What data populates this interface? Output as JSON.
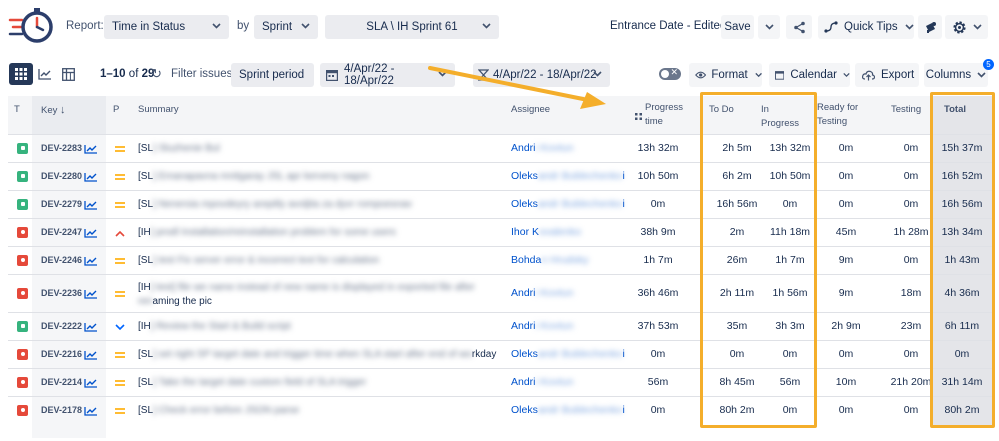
{
  "toolbar": {
    "report_label": "Report:",
    "report_value": "Time in Status",
    "by_label": "by",
    "groupby_value": "Sprint",
    "sprint_value": "SLA \\ IH Sprint 61",
    "entrance_date": "Entrance Date - Edited",
    "save_label": "Save",
    "quick_tips_label": "Quick Tips"
  },
  "controls": {
    "range_label": "1–10",
    "range_of": "of",
    "range_total": "29",
    "filter_label": "Filter issues:",
    "filter_value": "Sprint period",
    "date_range_1": "4/Apr/22 - 18/Apr/22",
    "date_range_2": "4/Apr/22 - 18/Apr/22",
    "format_label": "Format",
    "calendar_label": "Calendar",
    "export_label": "Export",
    "columns_label": "Columns",
    "columns_badge": "5"
  },
  "table": {
    "headers": {
      "type": "T",
      "key": "Key",
      "priority": "P",
      "summary": "Summary",
      "assignee": "Assignee",
      "progress_line1": "Progress",
      "progress_line2": "time",
      "todo": "To Do",
      "inprogress_line1": "In",
      "inprogress_line2": "Progress",
      "ready_line1": "Ready for",
      "ready_line2": "Testing",
      "testing": "Testing",
      "total": "Total"
    },
    "rows": [
      {
        "type": "story",
        "key": "DEV-2283",
        "priority": "medium",
        "summary": "[SL] Sluzhenie Bul",
        "summary_extra": "",
        "assignee": "Andri",
        "assignee_hidden": "i Kovtun",
        "progress": "13h 32m",
        "todo": "2h 5m",
        "inprogress": "13h 32m",
        "ready": "0m",
        "testing": "0m",
        "total": "15h 37m"
      },
      {
        "type": "story",
        "key": "DEV-2280",
        "priority": "medium",
        "summary": "[SL] Emanapavna mnitgaray  JSL apr kerveny nagon",
        "summary_extra": "",
        "assignee": "Oleks",
        "assignee_hidden": "andr Bublechenko",
        "assignee_tail": "i",
        "progress": "10h 50m",
        "todo": "6h 2m",
        "inprogress": "10h 50m",
        "ready": "0m",
        "testing": "0m",
        "total": "16h 52m"
      },
      {
        "type": "story",
        "key": "DEV-2279",
        "priority": "medium",
        "summary": "[SL] Nenersia mpovdeyry arepitly avoljita za dyvr rompoesnav",
        "summary_extra": "",
        "assignee": "Oleks",
        "assignee_hidden": "andr Bublechenko",
        "assignee_tail": "i",
        "progress": "0m",
        "todo": "16h 56m",
        "inprogress": "0m",
        "ready": "0m",
        "testing": "0m",
        "total": "16h 56m"
      },
      {
        "type": "bug",
        "key": "DEV-2247",
        "priority": "high",
        "summary": "[IH] prodl Installation/reinstallation problem for some users",
        "summary_extra": "",
        "assignee": "Ihor K",
        "assignee_hidden": "ovalenko",
        "assignee_tail": "",
        "progress": "38h 9m",
        "todo": "2m",
        "inprogress": "11h 18m",
        "ready": "45m",
        "testing": "1h 28m",
        "total": "13h 34m"
      },
      {
        "type": "bug",
        "key": "DEV-2246",
        "priority": "medium",
        "summary": "[SL] test Fix server error & incorrect text for calculation",
        "summary_extra": "",
        "assignee": "Bohda",
        "assignee_hidden": "n Hrudsky",
        "assignee_tail": "",
        "progress": "1h 7m",
        "todo": "26m",
        "inprogress": "1h 7m",
        "ready": "9m",
        "testing": "0m",
        "total": "1h 43m"
      },
      {
        "type": "bug",
        "key": "DEV-2236",
        "priority": "medium",
        "summary": "[IH] test] file we name instead of new name is displayed in exported file after",
        "summary_extra": "renaming the pic",
        "assignee": "Andri",
        "assignee_hidden": "i Kovtun",
        "assignee_tail": "",
        "progress": "36h 46m",
        "todo": "2h 11m",
        "inprogress": "1h 56m",
        "ready": "9m",
        "testing": "18m",
        "total": "4h 36m"
      },
      {
        "type": "story",
        "key": "DEV-2222",
        "priority": "low",
        "summary": "[IH] Review the Start & Build script",
        "summary_extra": "",
        "assignee": "Andri",
        "assignee_hidden": "i Kovtun",
        "assignee_tail": "",
        "progress": "37h 53m",
        "todo": "35m",
        "inprogress": "3h 3m",
        "ready": "2h 9m",
        "testing": "23m",
        "total": "6h 11m"
      },
      {
        "type": "bug",
        "key": "DEV-2216",
        "priority": "medium",
        "summary": "[SL] set right SP target date and trigger time when SLA start after end of wo",
        "summary_tail": "rkday",
        "summary_extra": "",
        "assignee": "Oleks",
        "assignee_hidden": "andr Bublechenko",
        "assignee_tail": "i",
        "progress": "0m",
        "todo": "0m",
        "inprogress": "0m",
        "ready": "0m",
        "testing": "0m",
        "total": "0m"
      },
      {
        "type": "bug",
        "key": "DEV-2214",
        "priority": "medium",
        "summary": "[SL] Take the target date custom field of SLA trigger",
        "summary_extra": "",
        "assignee": "Andri",
        "assignee_hidden": "i Kovtun",
        "assignee_tail": "",
        "progress": "56m",
        "todo": "8h 45m",
        "inprogress": "56m",
        "ready": "10m",
        "testing": "21h 20m",
        "total": "31h 14m"
      },
      {
        "type": "bug",
        "key": "DEV-2178",
        "priority": "medium",
        "summary": "[SL] Check error before  JSON parse",
        "summary_extra": "",
        "assignee": "Oleks",
        "assignee_hidden": "andr Bublechenko",
        "assignee_tail": "i",
        "progress": "0m",
        "todo": "80h 2m",
        "inprogress": "0m",
        "ready": "0m",
        "testing": "0m",
        "total": "80h 2m"
      }
    ]
  },
  "colors": {
    "highlight": "#f4ae2b",
    "link": "#0052cc",
    "story": "#36b37e",
    "bug": "#e5493a"
  }
}
